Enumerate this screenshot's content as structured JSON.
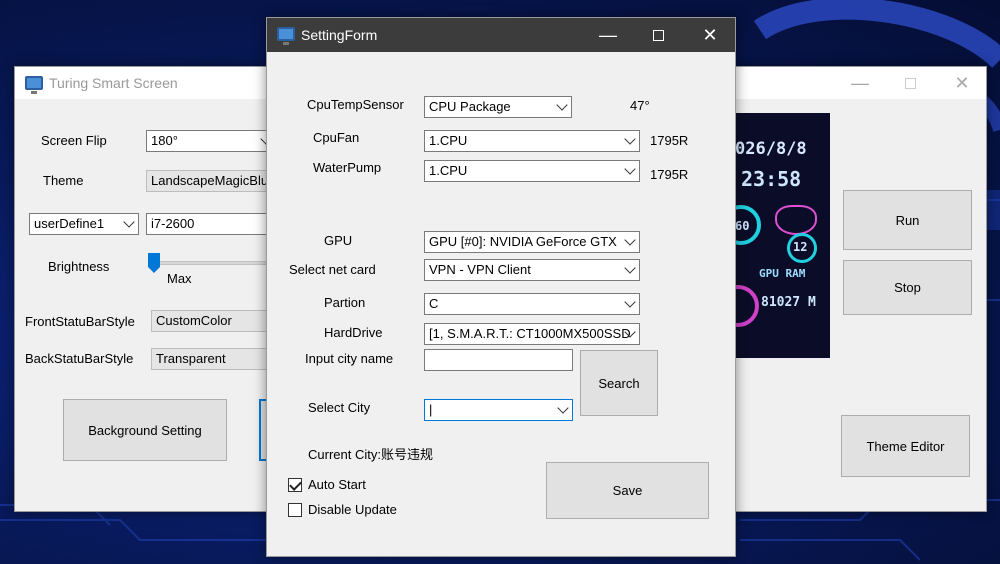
{
  "main_window": {
    "title": "Turing Smart Screen",
    "screen_flip_label": "Screen Flip",
    "screen_flip_value": "180°",
    "theme_label": "Theme",
    "theme_value": "LandscapeMagicBlue",
    "user_define_value": "userDefine1",
    "cpu_name_value": "i7-2600",
    "brightness_label": "Brightness",
    "brightness_max_label": "Max",
    "front_status_label": "FrontStatuBarStyle",
    "front_status_value": "CustomColor",
    "back_status_label": "BackStatuBarStyle",
    "back_status_value": "Transparent",
    "background_setting_label": "Background Setting",
    "run_label": "Run",
    "stop_label": "Stop",
    "theme_editor_label": "Theme Editor",
    "preview": {
      "date": "026/8/8",
      "time": "23:58",
      "ring_left": "60",
      "ring_right": "12",
      "gpu_ram_label": "GPU RAM",
      "gpu_ram_value": "81027 M"
    }
  },
  "setting_form": {
    "title": "SettingForm",
    "cpu_temp_sensor_label": "CpuTempSensor",
    "cpu_temp_sensor_value": "CPU Package",
    "cpu_temp_reading": "47°",
    "cpu_fan_label": "CpuFan",
    "cpu_fan_value": "1.CPU",
    "cpu_fan_reading": "1795R",
    "water_pump_label": "WaterPump",
    "water_pump_value": "1.CPU",
    "water_pump_reading": "1795R",
    "gpu_label": "GPU",
    "gpu_value": "GPU [#0]: NVIDIA GeForce GTX",
    "net_card_label": "Select net card",
    "net_card_value": "VPN - VPN Client",
    "partition_label": "Partion",
    "partition_value": "C",
    "hard_drive_label": "HardDrive",
    "hard_drive_value": "[1, S.M.A.R.T.: CT1000MX500SSD",
    "input_city_label": "Input city name",
    "input_city_value": "",
    "search_label": "Search",
    "select_city_label": "Select City",
    "select_city_value": "|",
    "current_city_text": "Current City:账号违规",
    "auto_start_label": "Auto Start",
    "auto_start_checked": true,
    "disable_update_label": "Disable Update",
    "disable_update_checked": false,
    "save_label": "Save"
  }
}
